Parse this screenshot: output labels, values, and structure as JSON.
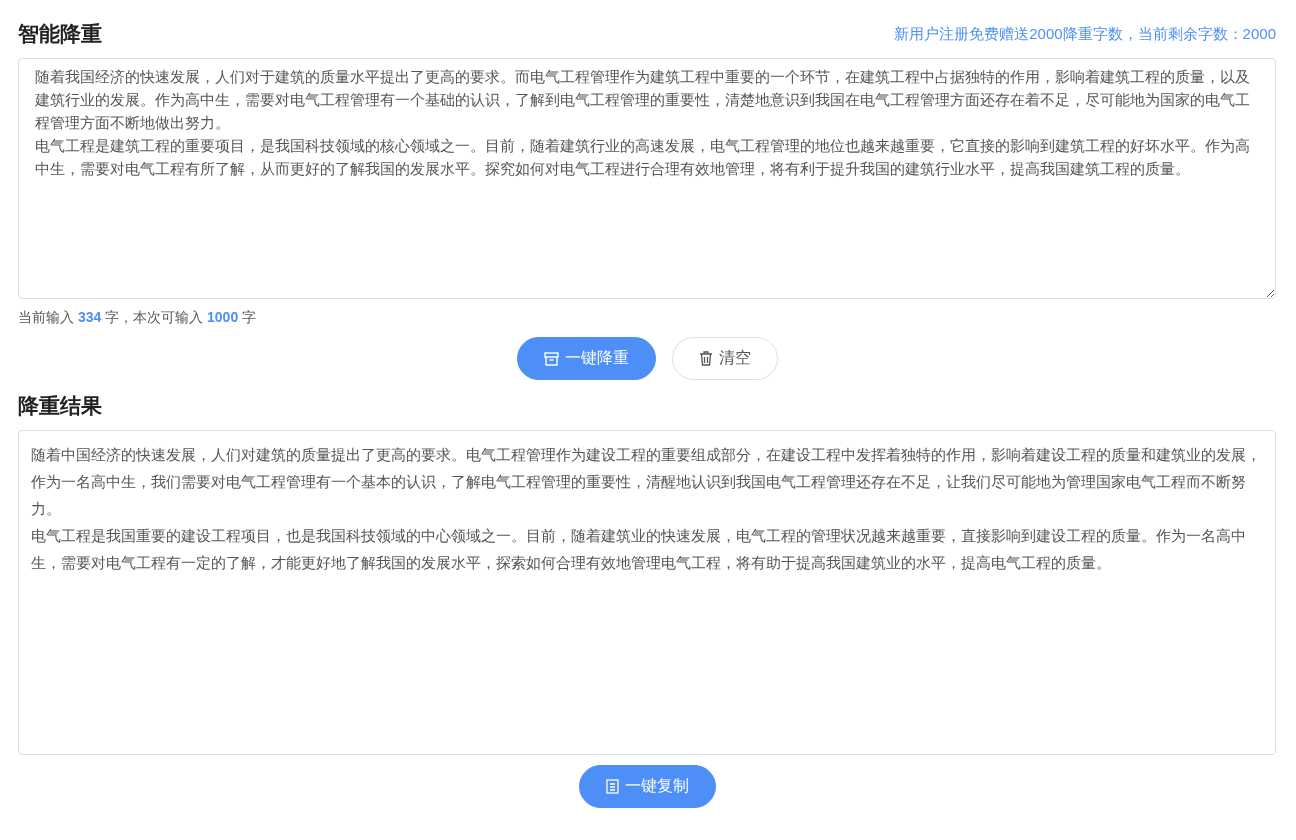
{
  "header": {
    "title": "智能降重",
    "notice": "新用户注册免费赠送2000降重字数，当前剩余字数：2000"
  },
  "input": {
    "paragraphs": [
      "随着我国经济的快速发展，人们对于建筑的质量水平提出了更高的要求。而电气工程管理作为建筑工程中重要的一个环节，在建筑工程中占据独特的作用，影响着建筑工程的质量，以及建筑行业的发展。作为高中生，需要对电气工程管理有一个基础的认识，了解到电气工程管理的重要性，清楚地意识到我国在电气工程管理方面还存在着不足，尽可能地为国家的电气工程管理方面不断地做出努力。",
      "电气工程是建筑工程的重要项目，是我国科技领域的核心领域之一。目前，随着建筑行业的高速发展，电气工程管理的地位也越来越重要，它直接的影响到建筑工程的好坏水平。作为高中生，需要对电气工程有所了解，从而更好的了解我国的发展水平。探究如何对电气工程进行合理有效地管理，将有利于提升我国的建筑行业水平，提高我国建筑工程的质量。"
    ],
    "counter": "当前输入 **334** 字，本次可输入 **1000** 字"
  },
  "actions": [
    {
      "label": "一键降重",
      "kind": "primary"
    },
    {
      "label": "清空",
      "kind": "secondary"
    }
  ],
  "result": {
    "title": "降重结果",
    "paragraphs": [
      "随着中国经济的快速发展，人们对建筑的质量提出了更高的要求。电气工程管理作为建设工程的重要组成部分，在建设工程中发挥着独特的作用，影响着建设工程的质量和建筑业的发展，作为一名高中生，我们需要对电气工程管理有一个基本的认识，了解电气工程管理的重要性，清醒地认识到我国电气工程管理还存在不足，让我们尽可能地为管理国家电气工程而不断努力。",
      "电气工程是我国重要的建设工程项目，也是我国科技领域的中心领域之一。目前，随着建筑业的快速发展，电气工程的管理状况越来越重要，直接影响到建设工程的质量。作为一名高中生，需要对电气工程有一定的了解，才能更好地了解我国的发展水平，探索如何合理有效地管理电气工程，将有助于提高我国建筑业的水平，提高电气工程的质量。"
    ],
    "copy_button": "一键复制"
  }
}
